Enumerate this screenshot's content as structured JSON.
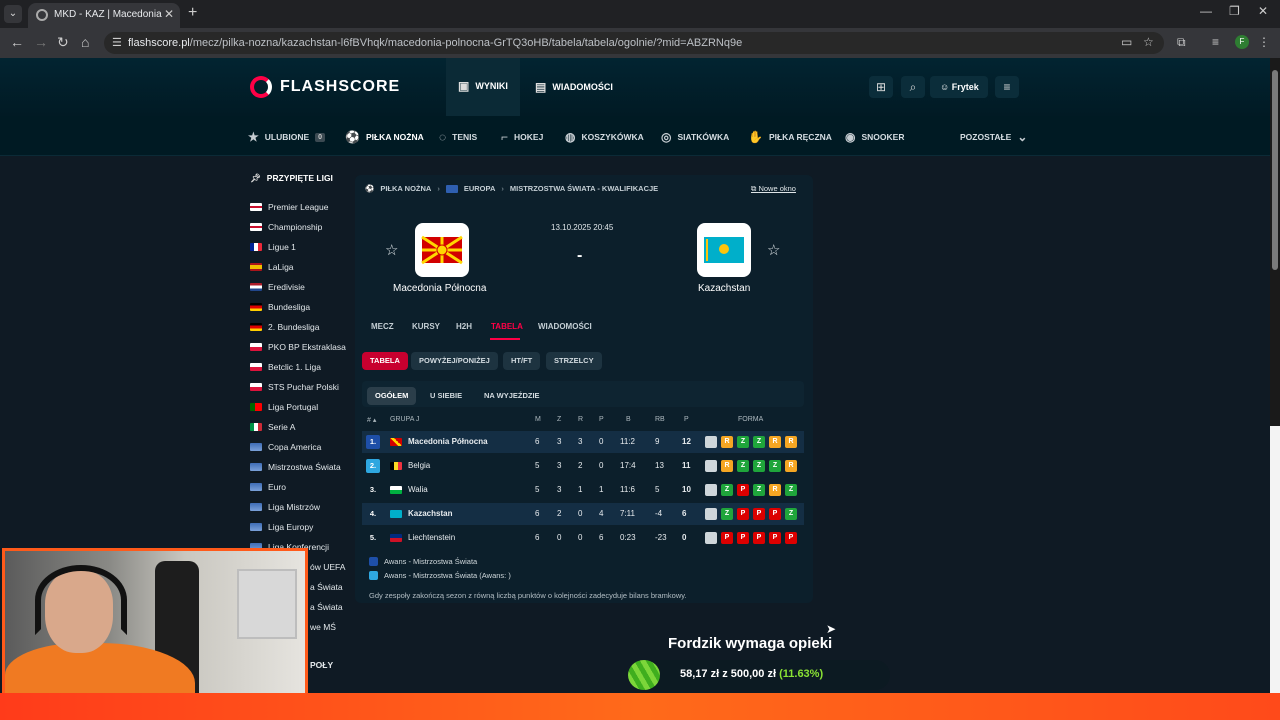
{
  "browser": {
    "tab_title": "MKD - KAZ | Macedonia Północna",
    "url_domain": "flashscore.pl",
    "url_path": "/mecz/pilka-nozna/kazachstan-l6fBVhqk/macedonia-polnocna-GrTQ3oHB/tabela/tabela/ogolnie/?mid=ABZRNq9e",
    "profile_initial": "F"
  },
  "site": {
    "logo": "FLASHSCORE",
    "nav": {
      "results": "WYNIKI",
      "news": "WIADOMOŚCI"
    },
    "user": "Frytek"
  },
  "sports": {
    "favourites": "ULUBIONE",
    "favourites_count": "0",
    "items": [
      "PIŁKA NOŻNA",
      "TENIS",
      "HOKEJ",
      "KOSZYKÓWKA",
      "SIATKÓWKA",
      "PIŁKA RĘCZNA",
      "SNOOKER"
    ],
    "more": "POZOSTAŁE"
  },
  "sidebar": {
    "title": "PRZYPIĘTE LIGI",
    "leagues": [
      "Premier League",
      "Championship",
      "Ligue 1",
      "LaLiga",
      "Eredivisie",
      "Bundesliga",
      "2. Bundesliga",
      "PKO BP Ekstraklasa",
      "Betclic 1. Liga",
      "STS Puchar Polski",
      "Liga Portugal",
      "Serie A",
      "Copa America",
      "Mistrzostwa Świata",
      "Euro",
      "Liga Mistrzów",
      "Liga Europy",
      "Liga Konferencji"
    ],
    "partial": [
      "ów UEFA",
      "a Świata",
      "a Świata",
      "we MŚ",
      "POŁY"
    ]
  },
  "match": {
    "breadcrumb": [
      "PIŁKA NOŻNA",
      "EUROPA",
      "MISTRZOSTWA ŚWIATA - KWALIFIKACJE"
    ],
    "new_window": "Nowe okno",
    "datetime": "13.10.2025 20:45",
    "score": "-",
    "home": "Macedonia Północna",
    "away": "Kazachstan",
    "tabs": [
      "MECZ",
      "KURSY",
      "H2H",
      "TABELA",
      "WIADOMOŚCI"
    ],
    "subtabs": [
      "TABELA",
      "POWYŻEJ/PONIŻEJ",
      "HT/FT",
      "STRZELCY"
    ],
    "filters": [
      "OGÓŁEM",
      "U SIEBIE",
      "NA WYJEŹDZIE"
    ]
  },
  "table": {
    "headers": {
      "rank": "# ▴",
      "group": "GRUPA J",
      "m": "M",
      "z": "Z",
      "r": "R",
      "p": "P",
      "b": "B",
      "rb": "RB",
      "pts": "P",
      "form": "FORMA"
    },
    "rows": [
      {
        "rank": "1.",
        "team": "Macedonia Północna",
        "m": "6",
        "z": "3",
        "r": "3",
        "p": "0",
        "b": "11:2",
        "rb": "9",
        "pts": "12",
        "form": [
          "?",
          "R",
          "Z",
          "Z",
          "R",
          "R"
        ]
      },
      {
        "rank": "2.",
        "team": "Belgia",
        "m": "5",
        "z": "3",
        "r": "2",
        "p": "0",
        "b": "17:4",
        "rb": "13",
        "pts": "11",
        "form": [
          "?",
          "R",
          "Z",
          "Z",
          "Z",
          "R"
        ]
      },
      {
        "rank": "3.",
        "team": "Walia",
        "m": "5",
        "z": "3",
        "r": "1",
        "p": "1",
        "b": "11:6",
        "rb": "5",
        "pts": "10",
        "form": [
          "?",
          "Z",
          "P",
          "Z",
          "R",
          "Z"
        ]
      },
      {
        "rank": "4.",
        "team": "Kazachstan",
        "m": "6",
        "z": "2",
        "r": "0",
        "p": "4",
        "b": "7:11",
        "rb": "-4",
        "pts": "6",
        "form": [
          "?",
          "Z",
          "P",
          "P",
          "P",
          "Z"
        ]
      },
      {
        "rank": "5.",
        "team": "Liechtenstein",
        "m": "6",
        "z": "0",
        "r": "0",
        "p": "6",
        "b": "0:23",
        "rb": "-23",
        "pts": "0",
        "form": [
          "?",
          "P",
          "P",
          "P",
          "P",
          "P"
        ]
      }
    ],
    "legend": [
      "Awans - Mistrzostwa Świata",
      "Awans - Mistrzostwa Świata (Awans: )"
    ],
    "note": "Gdy zespoły zakończą sezon z równą liczbą punktów o kolejności zadecyduje bilans bramkowy."
  },
  "donation": {
    "title": "Fordzik wymaga opieki",
    "current": "58,17 zł",
    "sep": "z",
    "goal": "500,00 zł",
    "percent": "(11.63%)",
    "progress_fraction": 0.1163
  },
  "colors": {
    "accent": "#ff0046",
    "win": "#1fa53b",
    "draw": "#f5a623",
    "loss": "#dc0000"
  }
}
